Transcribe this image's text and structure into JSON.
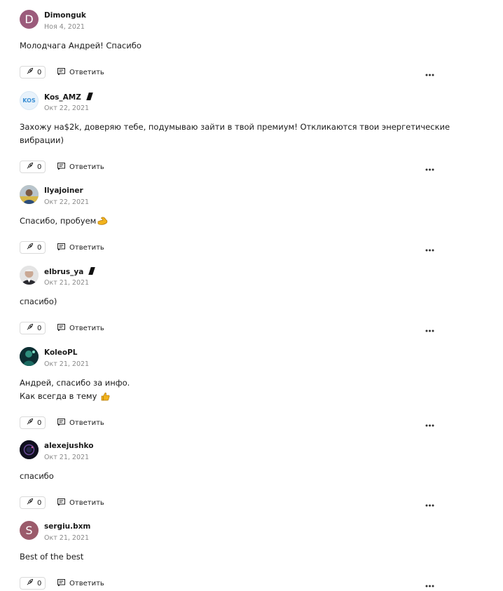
{
  "actions": {
    "reply_label": "Ответить"
  },
  "comments": [
    {
      "username": "Dimonguk",
      "date": "Ноя 4, 2021",
      "text_lines": [
        "Молодчага Андрей! Спасибо"
      ],
      "likes": "0",
      "avatar": {
        "type": "letter",
        "letter": "D",
        "color": "#9b5b7b"
      },
      "badge": false
    },
    {
      "username": "Kos_AMZ",
      "date": "Окт 22, 2021",
      "text_lines": [
        "Захожу на$2k, доверяю тебе, подумываю зайти в твой премиум! Откликаются твои энергетические",
        "вибрации)"
      ],
      "likes": "0",
      "avatar": {
        "type": "logo",
        "letter": "KOS",
        "color": "#e8f2fb"
      },
      "badge": true
    },
    {
      "username": "Ilyajoiner",
      "date": "Окт 22, 2021",
      "text_lines": [
        "Спасибо, пробуем"
      ],
      "text_emoji": "flexed-biceps",
      "likes": "0",
      "avatar": {
        "type": "photo",
        "color": "#c9b878"
      },
      "badge": false
    },
    {
      "username": "elbrus_ya",
      "date": "Окт 21, 2021",
      "text_lines": [
        "спасибо)"
      ],
      "likes": "0",
      "avatar": {
        "type": "photo",
        "color": "#d8d8d8"
      },
      "badge": true
    },
    {
      "username": "KoleoPL",
      "date": "Окт 21, 2021",
      "text_lines": [
        "Андрей, спасибо за инфо.",
        "Как всегда в тему"
      ],
      "text_emoji": "thumbs-up",
      "likes": "0",
      "avatar": {
        "type": "photo",
        "color": "#1e4a48"
      },
      "badge": false
    },
    {
      "username": "alexejushko",
      "date": "Окт 21, 2021",
      "text_lines": [
        "спасибо"
      ],
      "likes": "0",
      "avatar": {
        "type": "photo",
        "color": "#15152a"
      },
      "badge": false
    },
    {
      "username": "sergiu.bxm",
      "date": "Окт 21, 2021",
      "text_lines": [
        "Best of the best"
      ],
      "likes": "0",
      "avatar": {
        "type": "letter",
        "letter": "S",
        "color": "#9b5b6b"
      },
      "badge": false
    }
  ]
}
